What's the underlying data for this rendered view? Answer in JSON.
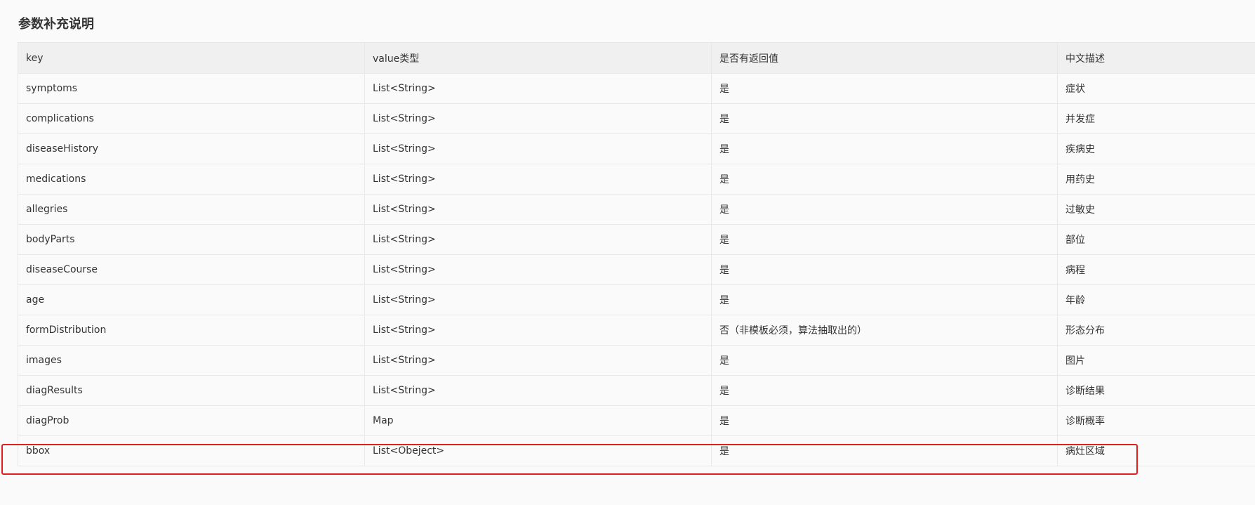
{
  "section": {
    "title": "参数补充说明"
  },
  "table": {
    "headers": [
      "key",
      "value类型",
      "是否有返回值",
      "中文描述"
    ],
    "rows": [
      {
        "key": "symptoms",
        "type": "List<String>",
        "returns": "是",
        "desc": "症状"
      },
      {
        "key": "complications",
        "type": "List<String>",
        "returns": "是",
        "desc": "并发症"
      },
      {
        "key": "diseaseHistory",
        "type": "List<String>",
        "returns": "是",
        "desc": "疾病史"
      },
      {
        "key": "medications",
        "type": "List<String>",
        "returns": "是",
        "desc": "用药史"
      },
      {
        "key": "allegries",
        "type": "List<String>",
        "returns": "是",
        "desc": "过敏史"
      },
      {
        "key": "bodyParts",
        "type": "List<String>",
        "returns": "是",
        "desc": "部位"
      },
      {
        "key": "diseaseCourse",
        "type": "List<String>",
        "returns": "是",
        "desc": "病程"
      },
      {
        "key": "age",
        "type": "List<String>",
        "returns": "是",
        "desc": "年龄"
      },
      {
        "key": "formDistribution",
        "type": "List<String>",
        "returns": "否（非模板必须，算法抽取出的）",
        "desc": "形态分布"
      },
      {
        "key": "images",
        "type": "List<String>",
        "returns": "是",
        "desc": "图片"
      },
      {
        "key": "diagResults",
        "type": "List<String>",
        "returns": "是",
        "desc": "诊断结果"
      },
      {
        "key": "diagProb",
        "type": "Map",
        "returns": "是",
        "desc": "诊断概率"
      },
      {
        "key": "bbox",
        "type": "List<Obeject>",
        "returns": "是",
        "desc": "病灶区域"
      }
    ]
  },
  "highlight": {
    "row_key": "bbox",
    "color": "#e0201f"
  },
  "colors": {
    "header_bg": "#f0f0f0",
    "row_bg": "#fafafa",
    "border": "#e8e8e8",
    "text": "#333333"
  }
}
